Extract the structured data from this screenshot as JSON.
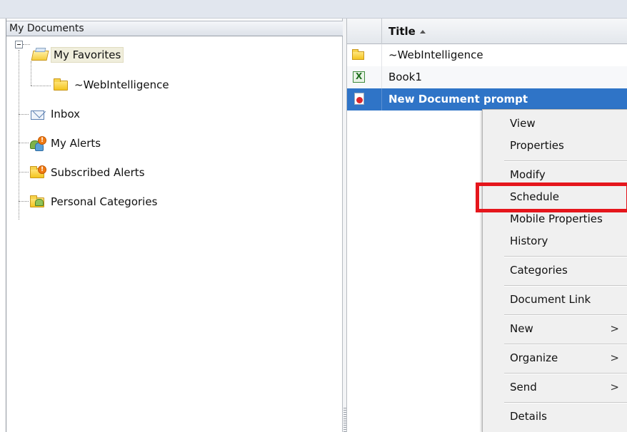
{
  "left_pane": {
    "header": "My Documents",
    "tree": [
      {
        "label": "My Favorites",
        "icon": "open-folder-icon"
      },
      {
        "label": "~WebIntelligence",
        "icon": "folder-icon"
      },
      {
        "label": "Inbox",
        "icon": "inbox-icon"
      },
      {
        "label": "My Alerts",
        "icon": "alerts-icon"
      },
      {
        "label": "Subscribed Alerts",
        "icon": "subscribed-alerts-icon"
      },
      {
        "label": "Personal Categories",
        "icon": "personal-categories-icon"
      }
    ],
    "alert_badge": "!"
  },
  "right_pane": {
    "title_header": "Title",
    "rows": [
      {
        "title": "~WebIntelligence",
        "icon": "folder-icon"
      },
      {
        "title": "Book1",
        "icon": "excel-icon"
      },
      {
        "title": "New Document prompt",
        "icon": "webi-document-icon"
      }
    ]
  },
  "context_menu": {
    "items": {
      "view": "View",
      "properties": "Properties",
      "modify": "Modify",
      "schedule": "Schedule",
      "mobile_properties": "Mobile Properties",
      "history": "History",
      "categories": "Categories",
      "document_link": "Document Link",
      "new": "New",
      "organize": "Organize",
      "send": "Send",
      "details": "Details"
    },
    "submenu_arrow": ">"
  },
  "colors": {
    "selection": "#2f74c7",
    "highlight": "#e5161c",
    "menu_bg": "#f0f0f0"
  }
}
